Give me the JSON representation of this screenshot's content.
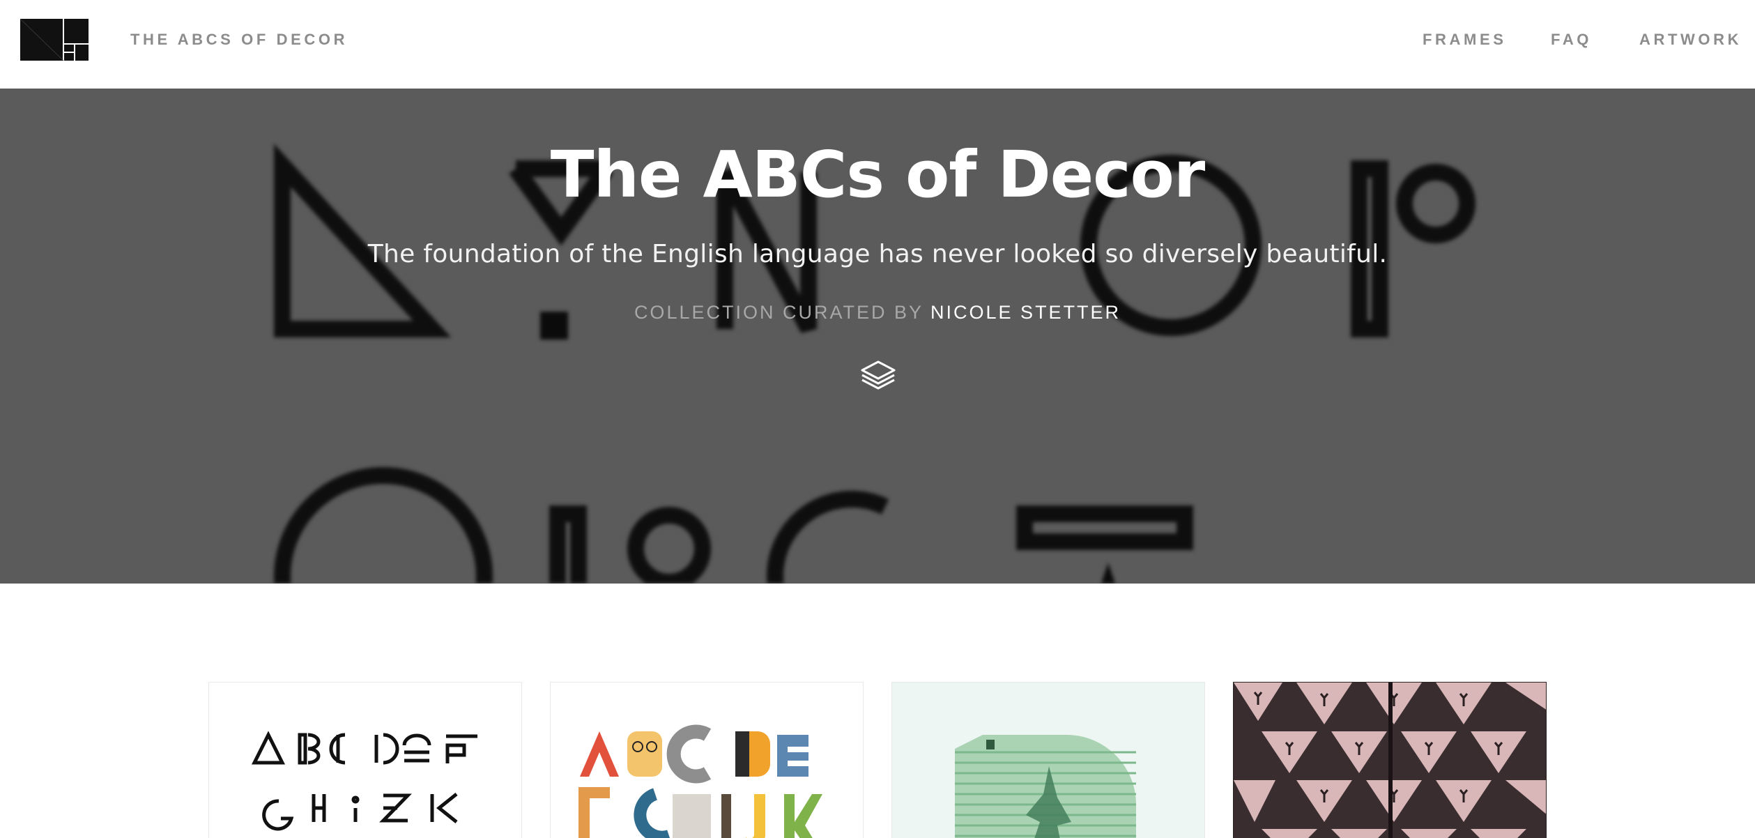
{
  "header": {
    "logo_icon": "frame-grid-logo-icon",
    "site_title": "THE ABCS OF DECOR",
    "nav": [
      {
        "label": "FRAMES"
      },
      {
        "label": "FAQ"
      },
      {
        "label": "ARTWORK"
      }
    ]
  },
  "hero": {
    "title": "The ABCs of Decor",
    "subtitle": "The foundation of the English language has never looked so diversely beautiful.",
    "curated_label": "COLLECTION CURATED BY",
    "curator": "NICOLE STETTER",
    "icon": "layers-icon",
    "background_color": "#5b5b5b"
  },
  "artworks": [
    {
      "name": "geometric-alphabet",
      "thumb_text_row1": "ABCDEF",
      "thumb_text_row2": "GHIJK"
    },
    {
      "name": "muppet-alphabet",
      "thumb_text_row1": "ABCDE",
      "thumb_text_row2": "FGHIJK"
    },
    {
      "name": "green-letter-d"
    },
    {
      "name": "kaleidoscope-pattern"
    }
  ]
}
